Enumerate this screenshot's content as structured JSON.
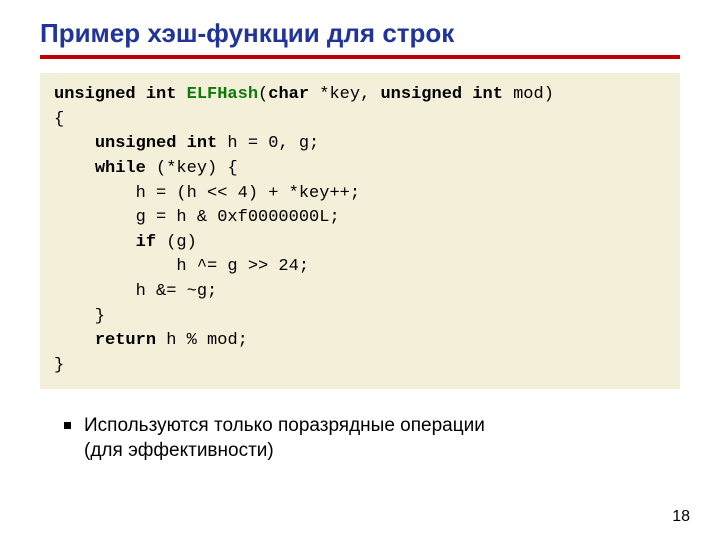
{
  "title": "Пример хэш-функции для строк",
  "code": {
    "l1a": "unsigned int ",
    "l1b": "ELFHash",
    "l1c": "(",
    "l1d": "char",
    "l1e": " *key, ",
    "l1f": "unsigned int",
    "l1g": " mod)",
    "l2": "{",
    "l3a": "    ",
    "l3b": "unsigned int",
    "l3c": " h = 0, g;",
    "l4a": "    ",
    "l4b": "while",
    "l4c": " (*key) {",
    "l5": "        h = (h << 4) + *key++;",
    "l6": "        g = h & 0xf0000000L;",
    "l7a": "        ",
    "l7b": "if",
    "l7c": " (g)",
    "l8": "            h ^= g >> 24;",
    "l9": "        h &= ~g;",
    "l10": "    }",
    "l11a": "    ",
    "l11b": "return",
    "l11c": " h % mod;",
    "l12": "}"
  },
  "bullet1_line1": "Используются только поразрядные операции",
  "bullet1_line2": "(для эффективности)",
  "page": "18"
}
